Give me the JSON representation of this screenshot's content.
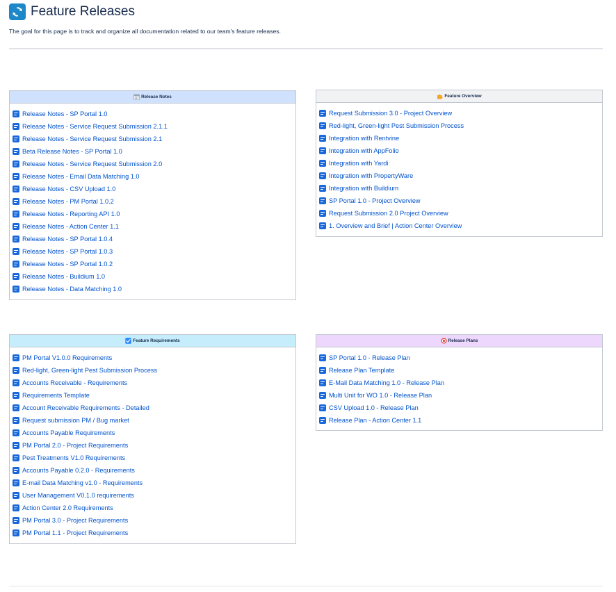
{
  "page": {
    "title": "Feature Releases",
    "description": "The goal for this page is to track and organize all documentation related to our team's feature releases.",
    "icon": "refresh-icon"
  },
  "panels": {
    "release_notes": {
      "title": "Release Notes",
      "icon": "calendar-icon",
      "header_color": "#cfe1fd",
      "items": [
        "Release Notes - SP Portal 1.0",
        "Release Notes - Service Request Submission 2.1.1",
        "Release Notes - Service Request Submission 2.1",
        "Beta Release Notes - SP Portal 1.0",
        "Release Notes - Service Request Submission 2.0",
        "Release Notes - Email Data Matching 1.0",
        "Release Notes - CSV Upload 1.0",
        "Release Notes - PM Portal 1.0.2",
        "Release Notes - Reporting API 1.0",
        "Release Notes - Action Center 1.1",
        "Release Notes - SP Portal 1.0.4",
        "Release Notes - SP Portal 1.0.3",
        "Release Notes - SP Portal 1.0.2",
        "Release Notes - Buildium 1.0",
        "Release Notes - Data Matching 1.0"
      ]
    },
    "feature_overview": {
      "title": "Feature Overview",
      "icon": "puzzle-icon",
      "header_color": "#f1f2f4",
      "items": [
        "Request Submission 3.0 - Project Overview",
        "Red-light, Green-light Pest Submission Process",
        "Integration with Rentvine",
        "Integration with AppFolio",
        "Integration with Yardi",
        "Integration with PropertyWare",
        "Integration with Buildium",
        "SP Portal 1.0 - Project Overview",
        "Request Submission 2.0 Project Overview",
        "1. Overview and Brief | Action Center Overview"
      ]
    },
    "feature_requirements": {
      "title": "Feature Requirements",
      "icon": "checkbox-icon",
      "header_color": "#c6edfb",
      "items": [
        "PM Portal V1.0.0 Requirements",
        "Red-light, Green-light Pest Submission Process",
        "Accounts Receivable - Requirements",
        "Requirements Template",
        "Account Receivable Requirements - Detailed",
        "Request submission PM / Bug market",
        "Accounts Payable Requirements",
        "PM Portal 2.0 - Project Requirements",
        "Pest Treatments V1.0 Requirements",
        "Accounts Payable 0.2.0 - Requirements",
        "E-mail Data Matching v1.0 - Requirements",
        "User Management V0.1.0 requirements",
        "Action Center 2.0 Requirements",
        "PM Portal 3.0 - Project Requirements",
        "PM Portal 1.1 - Project Requirements"
      ]
    },
    "release_plans": {
      "title": "Release Plans",
      "icon": "target-icon",
      "header_color": "#eed7fc",
      "items": [
        "SP Portal 1.0 - Release Plan",
        "Release Plan Template",
        "E-Mail Data Matching 1.0 - Release Plan",
        "Multi Unit for WO 1.0 - Release Plan",
        "CSV Upload 1.0 - Release Plan",
        "Release Plan - Action Center 1.1"
      ]
    }
  },
  "colors": {
    "link": "#0052cc",
    "doc_icon": "#1868db",
    "page_icon": "#1e87c8",
    "border": "#c1c7d0"
  }
}
